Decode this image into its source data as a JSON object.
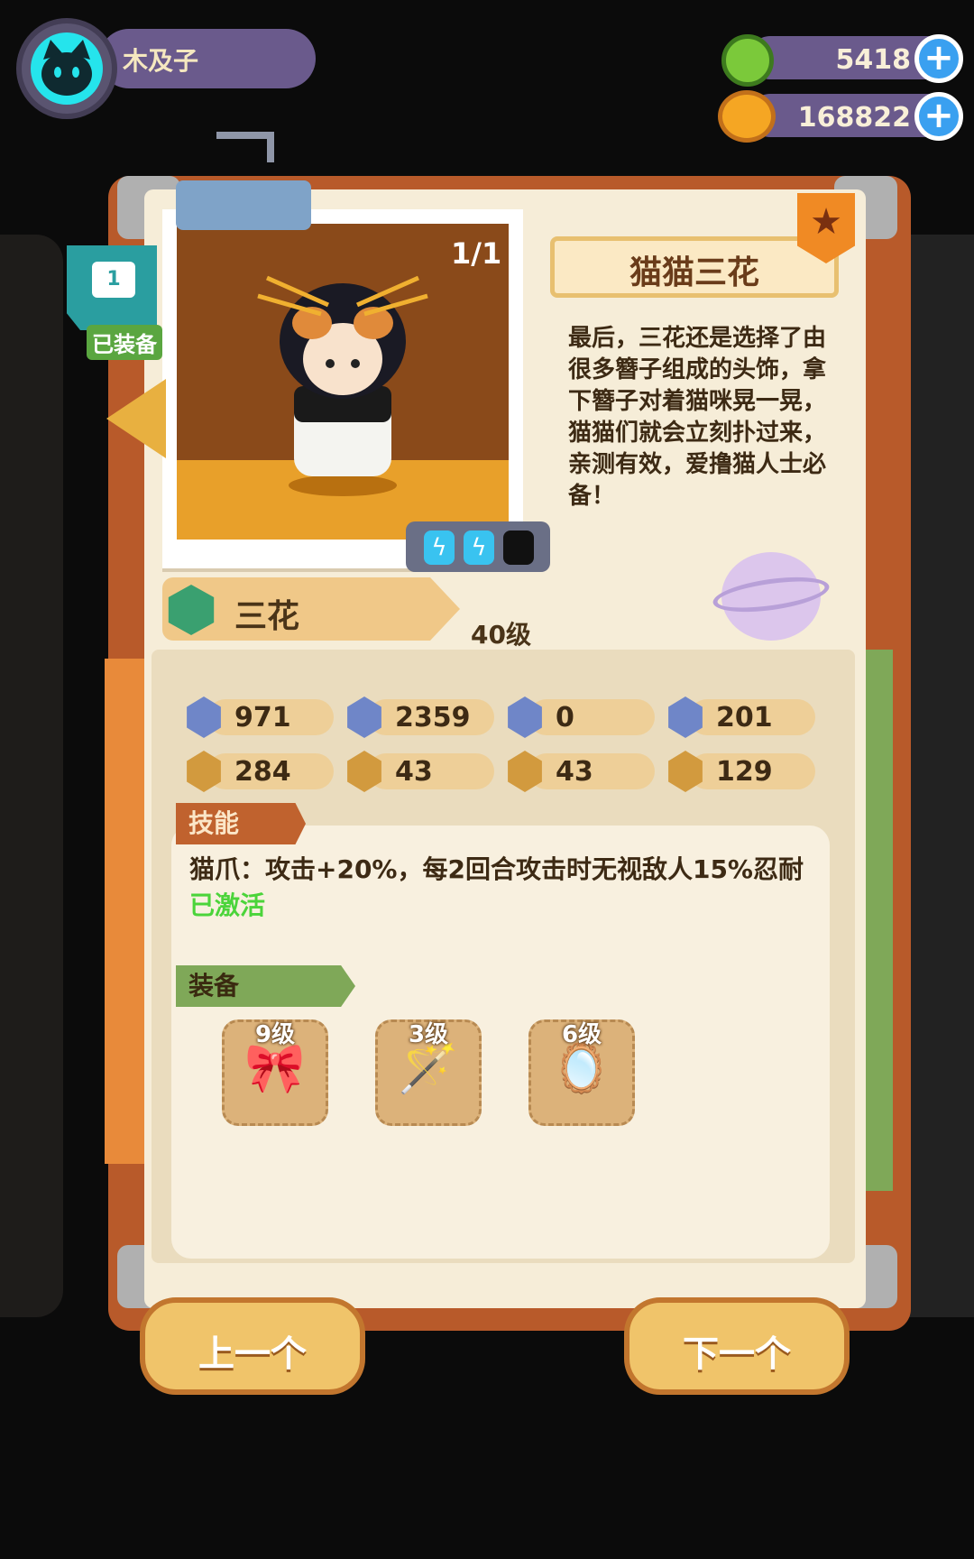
{
  "header": {
    "username": "木及子",
    "resources": [
      {
        "name": "green-coin",
        "value": "5418",
        "plus": "+"
      },
      {
        "name": "gold-coin",
        "value": "168822",
        "plus": "+"
      }
    ]
  },
  "equipped_tag": {
    "shirt_number": "1",
    "label": "已装备"
  },
  "card": {
    "counter": "1/1",
    "title": "猫猫三花",
    "description": "最后，三花还是选择了由很多簪子组成的头饰，拿下簪子对着猫咪晃一晃，猫猫们就会立刻扑过来，亲测有效，爱撸猫人士必备！",
    "name": "三花",
    "level": "40级",
    "energy": {
      "filled": 2,
      "total": 3
    }
  },
  "stats": [
    {
      "icon": "heart-shield-icon",
      "value": "971"
    },
    {
      "icon": "sword-icon",
      "value": "2359"
    },
    {
      "icon": "shield-icon",
      "value": "0"
    },
    {
      "icon": "anchor-icon",
      "value": "201"
    },
    {
      "icon": "claw-icon",
      "value": "284"
    },
    {
      "icon": "smile-icon",
      "value": "43"
    },
    {
      "icon": "muscle-icon",
      "value": "43"
    },
    {
      "icon": "brain-icon",
      "value": "129"
    }
  ],
  "skill": {
    "section_label": "技能",
    "text": "猫爪：攻击+20%，每2回合攻击时无视敌人15%忍耐",
    "status": "已激活"
  },
  "equipment": {
    "section_label": "装备",
    "items": [
      {
        "icon": "cat-ear-headband-icon",
        "level": "9级"
      },
      {
        "icon": "cat-teaser-wand-icon",
        "level": "3级"
      },
      {
        "icon": "compact-mirror-icon",
        "level": "6级"
      }
    ]
  },
  "buttons": {
    "prev": "上一个",
    "next": "下一个"
  },
  "colors": {
    "accent": "#f0c46a",
    "activated": "#4bd43a",
    "avatar": "#25e4ec"
  }
}
